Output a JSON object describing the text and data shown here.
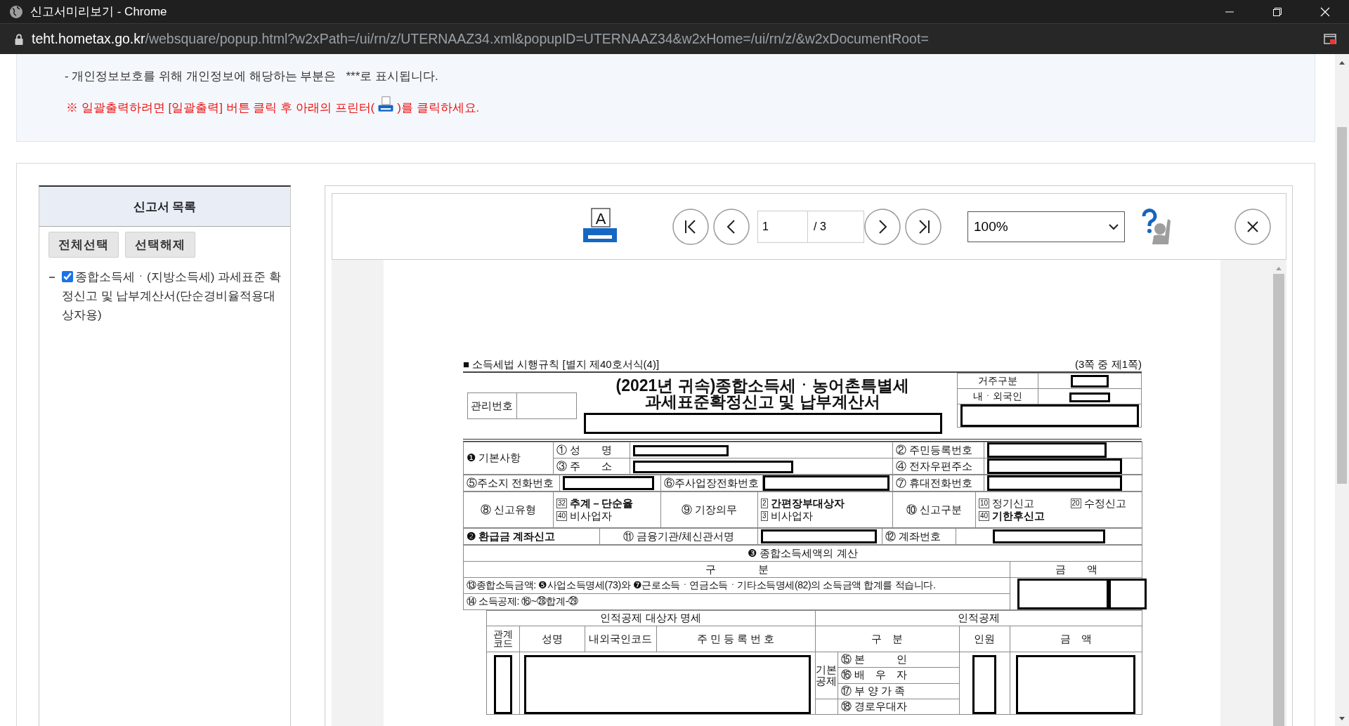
{
  "window": {
    "title": "신고서미리보기 - Chrome"
  },
  "address_bar": {
    "host": "teht.hometax.go.kr",
    "path": "/websquare/popup.html?w2xPath=/ui/rn/z/UTERNAAZ34.xml&popupID=UTERNAAZ34&w2xHome=/ui/rn/z/&w2xDocumentRoot="
  },
  "notice": {
    "privacy_line": "- 개인정보보호를 위해 개인정보에 해당하는 부분은   ***로 표시됩니다.",
    "print_hint_before": "※ 일괄출력하려면 [일괄출력] 버튼 클릭 후 아래의 프린터(",
    "print_hint_after": ")를 클릭하세요."
  },
  "report_list": {
    "title": "신고서 목록",
    "buttons": [
      "전체선택",
      "선택해제"
    ],
    "items": [
      {
        "label": "종합소득세ㆍ(지방소득세) 과세표준 확정신고 및 납부계산서(단순경비율적용대상자용)",
        "checked": true
      }
    ]
  },
  "viewer": {
    "print_letter": "A",
    "page": "1",
    "total": "/ 3",
    "zoom": "100%"
  },
  "form": {
    "rule": "■ 소득세법 시행규칙 [별지 제40호서식(4)]",
    "page_note": "(3쪽 중 제1쪽)",
    "title_lines": [
      "(2021년 귀속)종합소득세ㆍ농어촌특별세",
      "과세표준확정신고 및 납부계산서"
    ],
    "mgmt_label": "관리번호",
    "residence_labels": [
      "거주구분",
      "내ㆍ외국인"
    ],
    "basic": {
      "section": "❶ 기본사항",
      "fields": [
        "① 성　　명",
        "② 주민등록번호",
        "③ 주　　소",
        "④ 전자우편주소",
        "⑤주소지 전화번호",
        "⑥주사업장전화번호",
        "⑦ 휴대전화번호"
      ]
    },
    "filing": {
      "type_label": "⑧ 신고유형",
      "type_options": [
        {
          "code": "32",
          "text": "추계－단순율",
          "selected": true
        },
        {
          "code": "40",
          "text": "비사업자",
          "selected": false
        }
      ],
      "bookkeeping_label": "⑨ 기장의무",
      "bookkeeping_options": [
        {
          "code": "2",
          "text": "간편장부대상자",
          "selected": true
        },
        {
          "code": "3",
          "text": "비사업자",
          "selected": false
        }
      ],
      "category_label": "⑩ 신고구분",
      "category_options": [
        {
          "code": "10",
          "text": "정기신고",
          "selected": false
        },
        {
          "code": "20",
          "text": "수정신고",
          "selected": false
        },
        {
          "code": "40",
          "text": "기한후신고",
          "selected": true
        }
      ]
    },
    "refund": {
      "section": "❷ 환급금 계좌신고",
      "bank_label": "⑪ 금융기관/체신관서명",
      "account_label": "⑫ 계좌번호"
    },
    "calc": {
      "section": "❸ 종합소득세액의 계산",
      "col_item": "구　　　　분",
      "col_amount": "금　　액",
      "lines": [
        "⑬종합소득금액: ❺사업소득명세(73)와 ❼근로소득ㆍ연금소득ㆍ기타소득명세(82)의 소득금액 합계를 적습니다.",
        "⑭ 소득공제: ⑯~㉘합계-㉙"
      ]
    },
    "deduction": {
      "left_header": "인적공제 대상자 명세",
      "right_header": "인적공제",
      "columns": [
        "관계코드",
        "성명",
        "내외국인코드",
        "주 민 등 록 번 호",
        "구　분",
        "인원",
        "금　액"
      ],
      "group": "기본공제",
      "items": [
        "⑮ 본　　　인",
        "⑯ 배　우　자",
        "⑰ 부 양 가 족",
        "⑱ 경로우대자"
      ]
    }
  }
}
